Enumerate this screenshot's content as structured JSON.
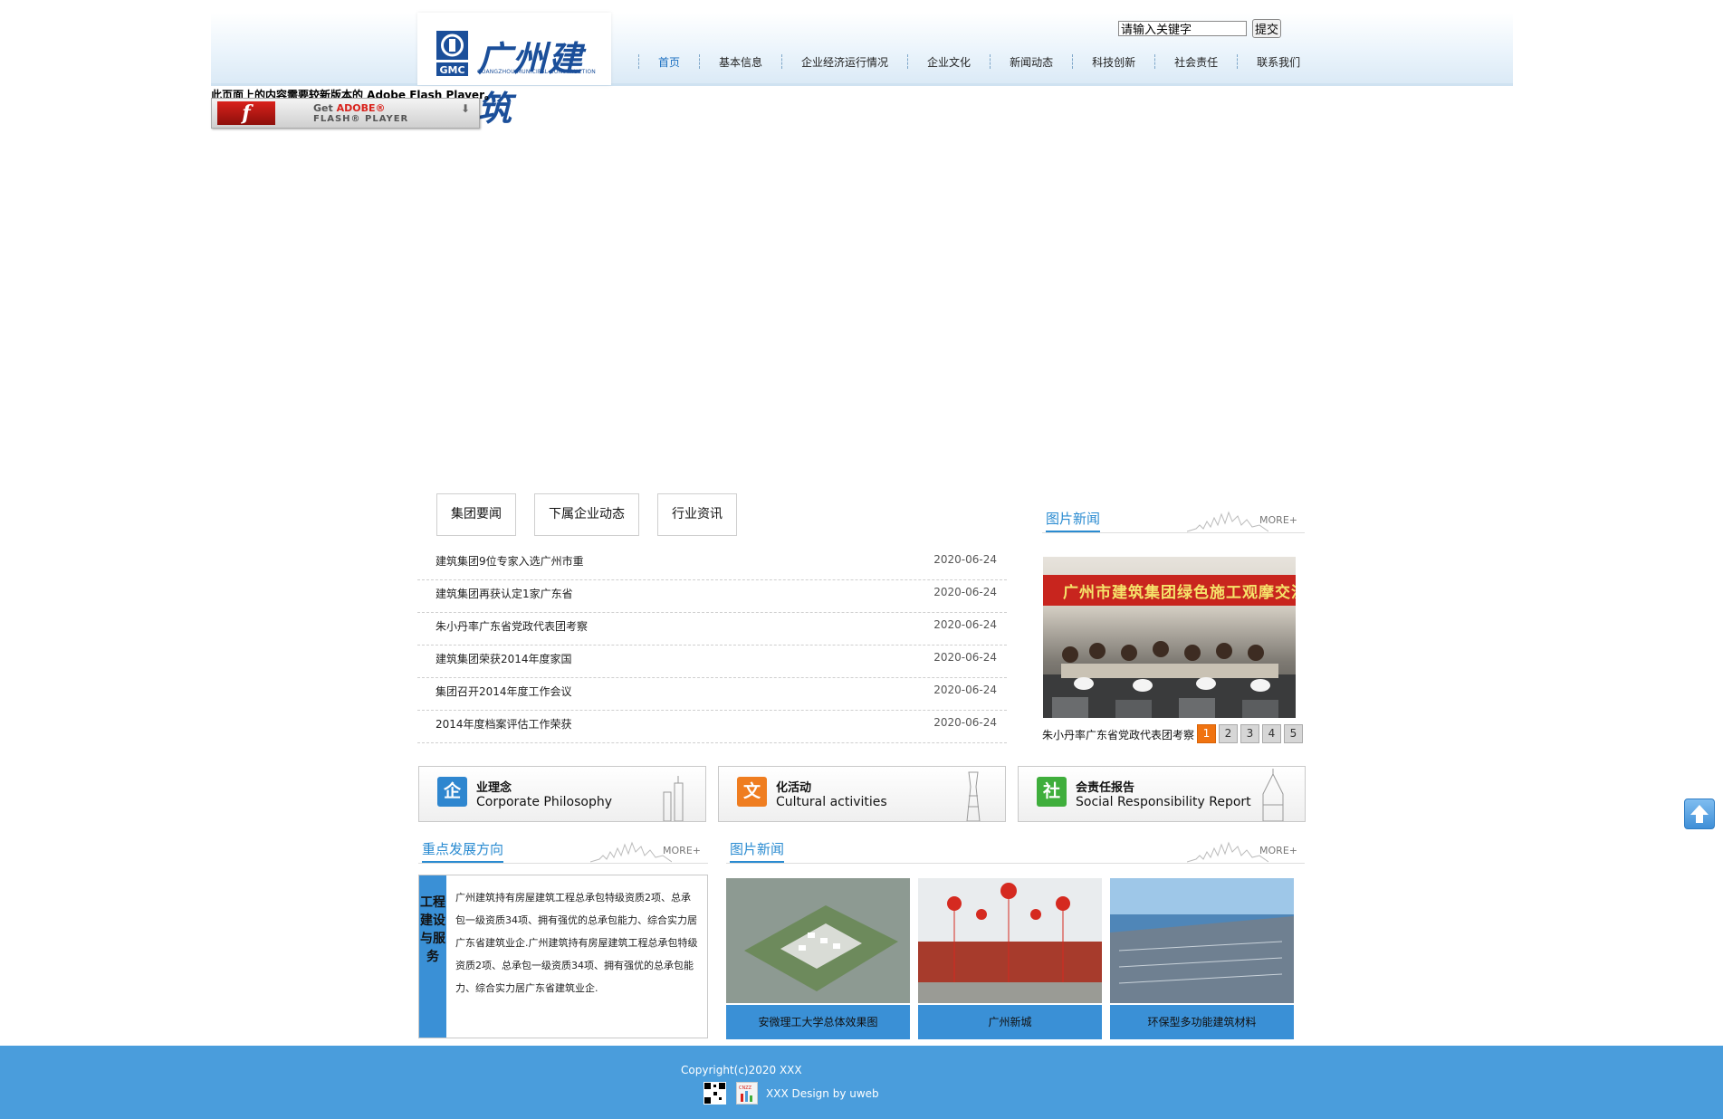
{
  "header": {
    "logo_cn": "广州建筑",
    "logo_en": "GUANGZHOU MUNICIPAL CONSTRUCTION",
    "logo_badge": "GMC",
    "search_value": "请输入关键字",
    "search_button": "提交",
    "nav": [
      {
        "label": "首页",
        "active": true
      },
      {
        "label": "基本信息"
      },
      {
        "label": "企业经济运行情况"
      },
      {
        "label": "企业文化"
      },
      {
        "label": "新闻动态"
      },
      {
        "label": "科技创新"
      },
      {
        "label": "社会责任"
      },
      {
        "label": "联系我们"
      }
    ]
  },
  "flash": {
    "notice": "此页面上的内容需要较新版本的 Adobe Flash Player。",
    "badge_get": "Get",
    "badge_adobe": "ADOBE®",
    "badge_player": "FLASH® PLAYER"
  },
  "news": {
    "tabs": [
      "集团要闻",
      "下属企业动态",
      "行业资讯"
    ],
    "items": [
      {
        "title": "建筑集团9位专家入选广州市重",
        "date": "2020-06-24"
      },
      {
        "title": "建筑集团再获认定1家广东省",
        "date": "2020-06-24"
      },
      {
        "title": "朱小丹率广东省党政代表团考察",
        "date": "2020-06-24"
      },
      {
        "title": "建筑集团荣获2014年度家国",
        "date": "2020-06-24"
      },
      {
        "title": "集团召开2014年度工作会议",
        "date": "2020-06-24"
      },
      {
        "title": "2014年度档案评估工作荣获",
        "date": "2020-06-24"
      }
    ]
  },
  "photo_news": {
    "title": "图片新闻",
    "more": "MORE+",
    "banner_text": "广州市建筑集团绿色施工观摩交流会",
    "caption": "朱小丹率广东省党政代表团考察",
    "pages": [
      "1",
      "2",
      "3",
      "4",
      "5"
    ],
    "active_page": "1"
  },
  "features": [
    {
      "icon_char": "企",
      "cn": "业理念",
      "en": "Corporate Philosophy",
      "color": "#2e86cf"
    },
    {
      "icon_char": "文",
      "cn": "化活动",
      "en": "Cultural activities",
      "color": "#ef7d20"
    },
    {
      "icon_char": "社",
      "cn": "会责任报告",
      "en": "Social Responsibility Report",
      "color": "#3fae3c"
    }
  ],
  "focus": {
    "title": "重点发展方向",
    "more": "MORE+",
    "side_label": "工程建设与服务",
    "body": "广州建筑持有房屋建筑工程总承包特级资质2项、总承包一级资质34项、拥有强优的总承包能力、综合实力居广东省建筑业企.广州建筑持有房屋建筑工程总承包特级资质2项、总承包一级资质34项、拥有强优的总承包能力、综合实力居广东省建筑业企."
  },
  "photo_news2": {
    "title": "图片新闻",
    "more": "MORE+",
    "tiles": [
      "安微理工大学总体效果图",
      "广州新城",
      "环保型多功能建筑材料"
    ]
  },
  "footer": {
    "copyright": "Copyright(c)2020 XXX",
    "design": "XXX Design by uweb",
    "cnzz": "CNZZ"
  },
  "colors": {
    "accent": "#2a8bd1",
    "footer": "#4a9ddc",
    "pager_active": "#f07310"
  }
}
